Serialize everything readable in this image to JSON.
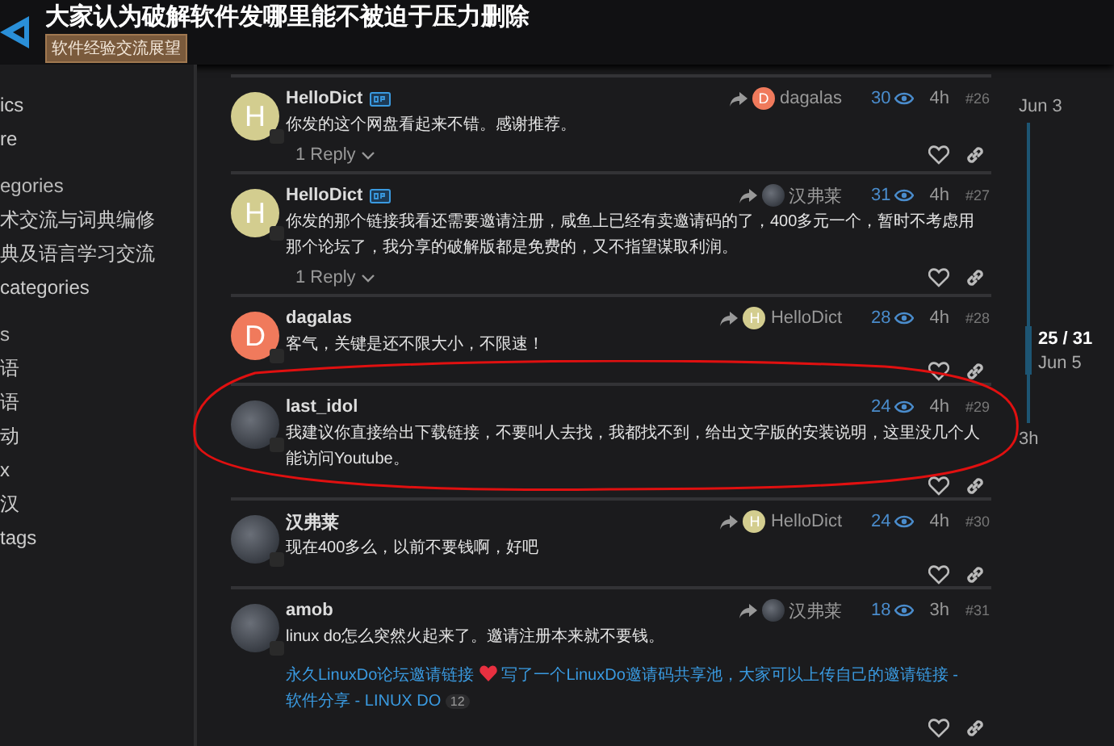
{
  "header": {
    "title": "大家认为破解软件发哪里能不被迫于压力删除",
    "category": "软件经验交流展望"
  },
  "sidebar": {
    "items": [
      {
        "label": "ics",
        "kind": "link"
      },
      {
        "label": "re",
        "kind": "link"
      },
      {
        "label": "egories",
        "kind": "heading"
      },
      {
        "label": "术交流与词典编修",
        "kind": "link"
      },
      {
        "label": "典及语言学习交流",
        "kind": "link"
      },
      {
        "label": "categories",
        "kind": "link"
      },
      {
        "label": "s",
        "kind": "heading"
      },
      {
        "label": "语",
        "kind": "link"
      },
      {
        "label": "语",
        "kind": "link"
      },
      {
        "label": "动",
        "kind": "link"
      },
      {
        "label": "x",
        "kind": "link"
      },
      {
        "label": "汉",
        "kind": "link"
      },
      {
        "label": "tags",
        "kind": "link"
      }
    ]
  },
  "posts": [
    {
      "username": "HelloDict",
      "op": true,
      "avatar": {
        "kind": "letter",
        "letter": "H",
        "color": "#d3cd8f"
      },
      "reply_to": {
        "name": "dagalas",
        "avatar": {
          "kind": "letter",
          "letter": "D",
          "color": "#f07a5c"
        }
      },
      "views": "30",
      "time": "4h",
      "number": "#26",
      "body": "你发的这个网盘看起来不错。感谢推荐。",
      "replies": "1 Reply"
    },
    {
      "username": "HelloDict",
      "op": true,
      "avatar": {
        "kind": "letter",
        "letter": "H",
        "color": "#d3cd8f"
      },
      "reply_to": {
        "name": "汉弗莱",
        "avatar": {
          "kind": "photo"
        }
      },
      "views": "31",
      "time": "4h",
      "number": "#27",
      "body": "你发的那个链接我看还需要邀请注册，咸鱼上已经有卖邀请码的了，400多元一个，暂时不考虑用那个论坛了，我分享的破解版都是免费的，又不指望谋取利润。",
      "replies": "1 Reply"
    },
    {
      "username": "dagalas",
      "op": false,
      "avatar": {
        "kind": "letter",
        "letter": "D",
        "color": "#f07a5c"
      },
      "reply_to": {
        "name": "HelloDict",
        "avatar": {
          "kind": "letter",
          "letter": "H",
          "color": "#d3cd8f"
        }
      },
      "views": "28",
      "time": "4h",
      "number": "#28",
      "body": "客气，关键是还不限大小，不限速！"
    },
    {
      "username": "last_idol",
      "op": false,
      "avatar": {
        "kind": "photo"
      },
      "views": "24",
      "time": "4h",
      "number": "#29",
      "body": "我建议你直接给出下载链接，不要叫人去找，我都找不到，给出文字版的安装说明，这里没几个人能访问Youtube。"
    },
    {
      "username": "汉弗莱",
      "op": false,
      "avatar": {
        "kind": "photo"
      },
      "reply_to": {
        "name": "HelloDict",
        "avatar": {
          "kind": "letter",
          "letter": "H",
          "color": "#d3cd8f"
        }
      },
      "views": "24",
      "time": "4h",
      "number": "#30",
      "body": "现在400多么，以前不要钱啊，好吧"
    },
    {
      "username": "amob",
      "op": false,
      "avatar": {
        "kind": "photo"
      },
      "reply_to": {
        "name": "汉弗莱",
        "avatar": {
          "kind": "photo"
        }
      },
      "views": "18",
      "time": "3h",
      "number": "#31",
      "body": "linux do怎么突然火起来了。邀请注册本来就不要钱。",
      "links": {
        "first": "永久LinuxDo论坛邀请链接",
        "second": "写了一个LinuxDo邀请码共享池，大家可以上传自己的邀请链接 - 软件分享 - LINUX DO",
        "count": "12"
      }
    }
  ],
  "timeline": {
    "start": "Jun 3",
    "position": "25 / 31",
    "date": "Jun 5",
    "end": "3h"
  }
}
